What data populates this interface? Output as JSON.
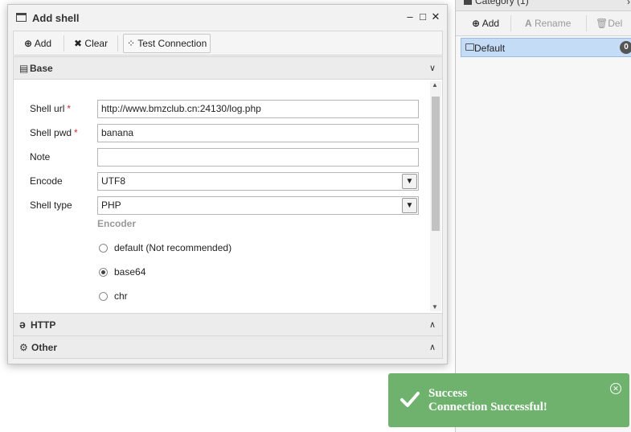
{
  "category_panel": {
    "title": "Category (1)",
    "toolbar": {
      "add_label": "Add",
      "rename_label": "Rename",
      "del_label": "Del"
    },
    "items": [
      {
        "label": "Default",
        "count": "0"
      }
    ]
  },
  "dialog": {
    "title": "Add shell",
    "toolbar": {
      "add_label": "Add",
      "clear_label": "Clear",
      "test_label": "Test Connection"
    },
    "sections": {
      "base": "Base",
      "http": "HTTP",
      "other": "Other"
    },
    "form": {
      "shell_url": {
        "label": "Shell url",
        "value": "http://www.bmzclub.cn:24130/log.php"
      },
      "shell_pwd": {
        "label": "Shell pwd",
        "value": "banana"
      },
      "note": {
        "label": "Note",
        "value": ""
      },
      "encode": {
        "label": "Encode",
        "value": "UTF8"
      },
      "shell_type": {
        "label": "Shell type",
        "value": "PHP"
      },
      "required_mark": "*",
      "encoder": {
        "title": "Encoder",
        "options": [
          {
            "label": "default (Not recommended)",
            "checked": false
          },
          {
            "label": "base64",
            "checked": true
          },
          {
            "label": "chr",
            "checked": false
          }
        ]
      }
    }
  },
  "toast": {
    "title": "Success",
    "message": "Connection Successful!"
  },
  "colors": {
    "toast_bg": "#6eb26e",
    "selected_item": "#c5dcf7",
    "required": "#d93030"
  }
}
